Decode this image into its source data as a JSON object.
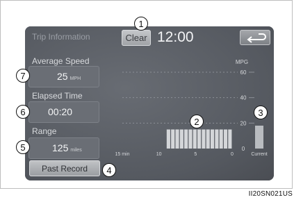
{
  "header": {
    "title": "Trip Information",
    "clear_label": "Clear",
    "time": "12:00"
  },
  "stats": {
    "average_speed": {
      "label": "Average Speed",
      "value": "25",
      "unit": "MPH"
    },
    "elapsed_time": {
      "label": "Elapsed Time",
      "value": "00:20"
    },
    "range": {
      "label": "Range",
      "value": "125",
      "unit": "miles"
    }
  },
  "past_record_label": "Past Record",
  "chart": {
    "unit": "MPG",
    "y_ticks": [
      "60",
      "40",
      "20",
      "0"
    ],
    "x_ticks": [
      "15 min",
      "10",
      "5",
      "0"
    ],
    "current_label": "Current"
  },
  "chart_data": {
    "type": "bar",
    "ylabel": "MPG",
    "ylim": [
      0,
      60
    ],
    "x_ticks": [
      "15 min",
      "10",
      "5",
      "0"
    ],
    "history_values": [
      0,
      0,
      0,
      0,
      0,
      0,
      0,
      0,
      0,
      0,
      15,
      15,
      15,
      15,
      15,
      15,
      15,
      15,
      15,
      15,
      15,
      15,
      15,
      15,
      15
    ],
    "current_value": 18
  },
  "callouts": [
    "1",
    "2",
    "3",
    "4",
    "5",
    "6",
    "7"
  ],
  "caption": "II20SN021US",
  "colors": {
    "screen_bg": "#5b5f66",
    "bar_fill": "#d4d6d9",
    "text_light": "#f2f3f5"
  }
}
